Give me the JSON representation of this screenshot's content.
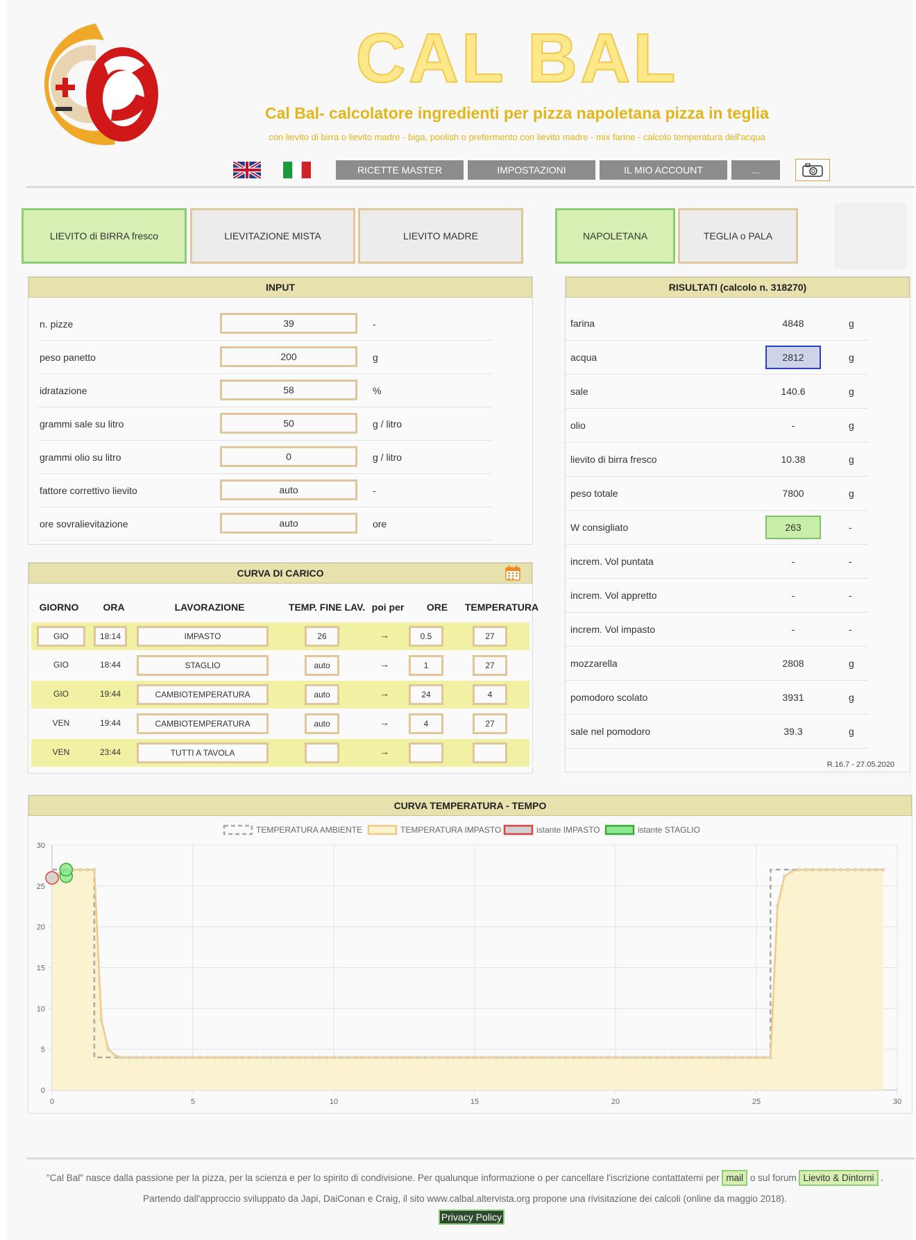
{
  "header": {
    "title": "CAL BAL",
    "subtitle": "Cal Bal-    calcolatore ingredienti per  pizza   napoletana  pizza in  teglia",
    "tagline": "con lievito di birra o lievito madre - biga, poolish o prefermento con lievito madre - mix farine - calcolo temperatura dell'acqua",
    "colors": {
      "title_fill": "#ffe88a",
      "title_stroke": "#f2c94c",
      "subtitle": "#e4b519"
    }
  },
  "nav": {
    "flags": [
      "uk-flag",
      "italy-flag"
    ],
    "ricette": "RICETTE MASTER",
    "impostazioni": "IMPOSTAZIONI",
    "account": "IL MIO ACCOUNT",
    "more": "...",
    "camera_icon": "camera-icon"
  },
  "leavening_types": [
    "LIEVITO di BIRRA fresco",
    "LIEVITAZIONE MISTA",
    "LIEVITO MADRE"
  ],
  "pizza_types": [
    "NAPOLETANA",
    "TEGLIA o PALA"
  ],
  "input": {
    "title": "INPUT",
    "rows": [
      {
        "label": "n. pizze",
        "value": "39",
        "unit": "-"
      },
      {
        "label": "peso panetto",
        "value": "200",
        "unit": "g"
      },
      {
        "label": "idratazione",
        "value": "58",
        "unit": "%"
      },
      {
        "label": "grammi sale su litro",
        "value": "50",
        "unit": "g / litro"
      },
      {
        "label": "grammi olio su litro",
        "value": "0",
        "unit": "g / litro"
      },
      {
        "label": "fattore correttivo lievito",
        "value": "auto",
        "unit": "-"
      },
      {
        "label": "ore sovralievitazione",
        "value": "auto",
        "unit": "ore"
      }
    ]
  },
  "results": {
    "title": "RISULTATI (calcolo n. 318270)",
    "rows": [
      {
        "label": "farina",
        "value": "4848",
        "unit": "g"
      },
      {
        "label": "acqua",
        "value": "2812",
        "unit": "g"
      },
      {
        "label": "sale",
        "value": "140.6",
        "unit": "g"
      },
      {
        "label": "olio",
        "value": "-",
        "unit": "g"
      },
      {
        "label": "lievito di birra fresco",
        "value": "10.38",
        "unit": "g"
      },
      {
        "label": "peso totale",
        "value": "7800",
        "unit": "g"
      },
      {
        "label": "W consigliato",
        "value": "263",
        "unit": "-"
      },
      {
        "label": "increm. Vol puntata",
        "value": "-",
        "unit": "-"
      },
      {
        "label": "increm. Vol appretto",
        "value": "-",
        "unit": "-"
      },
      {
        "label": "increm. Vol impasto",
        "value": "-",
        "unit": "-"
      },
      {
        "label": "mozzarella",
        "value": "2808",
        "unit": "g"
      },
      {
        "label": "pomodoro scolato",
        "value": "3931",
        "unit": "g"
      },
      {
        "label": "sale nel pomodoro",
        "value": "39.3",
        "unit": "g"
      }
    ],
    "version": "R.16.7 - 27.05.2020"
  },
  "curve": {
    "title": "CURVA DI CARICO",
    "headers": [
      "GIORNO",
      "ORA",
      "LAVORAZIONE",
      "TEMP. FINE LAV.",
      "poi per",
      "ORE",
      "TEMPERATURA"
    ],
    "rows": [
      {
        "giorno": "GIO",
        "ora": "18:14",
        "lavorazione": "IMPASTO",
        "temp": "26",
        "arrow": "→",
        "ore": "0.5",
        "temperatura": "27"
      },
      {
        "giorno": "GIO",
        "ora": "18:44",
        "lavorazione": "STAGLIO",
        "temp": "auto",
        "arrow": "→",
        "ore": "1",
        "temperatura": "27"
      },
      {
        "giorno": "GIO",
        "ora": "19:44",
        "lavorazione": "CAMBIOTEMPERATURA",
        "temp": "auto",
        "arrow": "→",
        "ore": "24",
        "temperatura": "4"
      },
      {
        "giorno": "VEN",
        "ora": "19:44",
        "lavorazione": "CAMBIOTEMPERATURA",
        "temp": "auto",
        "arrow": "→",
        "ore": "4",
        "temperatura": "27"
      },
      {
        "giorno": "VEN",
        "ora": "23:44",
        "lavorazione": "TUTTI  A TAVOLA",
        "temp": "",
        "arrow": "→",
        "ore": "",
        "temperatura": ""
      }
    ]
  },
  "graph": {
    "title": "CURVA TEMPERATURA - TEMPO"
  },
  "chart_data": {
    "type": "line",
    "xlim": [
      0,
      30
    ],
    "ylim": [
      0,
      30
    ],
    "xticks": [
      0,
      5,
      10,
      15,
      20,
      25,
      30
    ],
    "yticks": [
      0,
      5,
      10,
      15,
      20,
      25,
      30
    ],
    "grid": true,
    "legend_position": "top",
    "series": [
      {
        "name": "TEMPERATURA AMBIENTE",
        "color": "#a8a8a8",
        "style": "dashed",
        "x": [
          0,
          1.5,
          1.5,
          25.5,
          25.5,
          29.5
        ],
        "y": [
          27,
          27,
          4,
          4,
          27,
          27
        ]
      },
      {
        "name": "TEMPERATURA IMPASTO",
        "color": "#f0c98a",
        "fill": "#fbf3d0",
        "style": "solid",
        "x": [
          0,
          0.5,
          1.0,
          1.5,
          1.75,
          2.0,
          2.25,
          2.5,
          25.5,
          25.75,
          26.0,
          26.25,
          26.5,
          29.5
        ],
        "y": [
          26,
          27,
          27,
          27,
          8.6,
          5.0,
          4.2,
          4.0,
          4.0,
          22.6,
          26.2,
          26.8,
          27,
          27
        ]
      },
      {
        "name": "istante IMPASTO",
        "color": "#e04040",
        "fill": "#d0d0d0",
        "style": "point",
        "x": [
          0
        ],
        "y": [
          26
        ]
      },
      {
        "name": "istante STAGLIO",
        "color": "#3aa83a",
        "fill": "#90e890",
        "style": "point",
        "x": [
          0.5,
          0.5
        ],
        "y": [
          26.2,
          27
        ]
      }
    ]
  },
  "footer": {
    "line1_pre": "\"Cal Bal\" nasce dalla passione per la pizza, per la scienza e per lo spirito di condivisione. Per qualunque informazione o per cancellare l'iscrizione contattatemi per ",
    "mail": "mail",
    "line1_mid": " o sul forum ",
    "forum": "Lievito & Dintorni",
    "line1_post": " .",
    "line2": "Partendo dall'approccio sviluppato da Japi, DaiConan e Craig, il sito www.calbal.altervista.org propone una rivisitazione dei calcoli (online da maggio 2018).",
    "privacy": "Privacy Policy"
  }
}
